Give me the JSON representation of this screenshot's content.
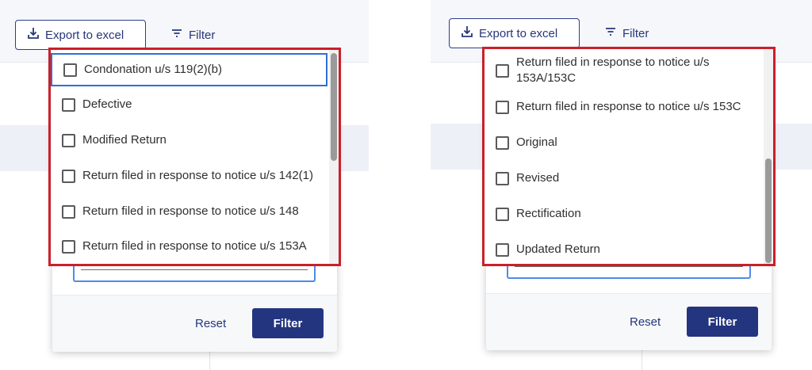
{
  "left": {
    "export_label": "Export to excel",
    "filter_link_label": "Filter",
    "reset_label": "Reset",
    "filter_button_label": "Filter",
    "options": [
      "Condonation u/s 119(2)(b)",
      "Defective",
      "Modified Return",
      "Return filed in response to notice u/s 142(1)",
      "Return filed in response to notice u/s 148",
      "Return filed in response to notice u/s 153A"
    ]
  },
  "right": {
    "export_label": "Export to excel",
    "filter_link_label": "Filter",
    "reset_label": "Reset",
    "filter_button_label": "Filter",
    "options": [
      "Return filed in response to notice u/s 153A/153C",
      "Return filed in response to notice u/s 153C",
      "Original",
      "Revised",
      "Rectification",
      "Updated Return"
    ]
  },
  "colors": {
    "highlight_border": "#c9202a",
    "primary": "#24357f",
    "focus": "#2f6fd6"
  },
  "icons": {
    "export": "download-tray-icon",
    "filter": "filter-lines-icon"
  }
}
